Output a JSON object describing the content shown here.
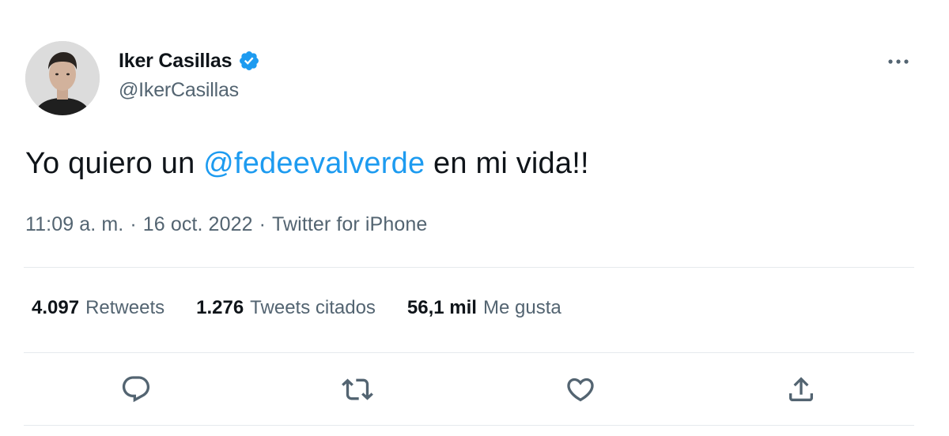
{
  "author": {
    "display_name": "Iker Casillas",
    "handle": "@IkerCasillas",
    "verified_icon": "verified-badge-icon",
    "avatar": "profile-photo"
  },
  "tweet": {
    "text_before": "Yo quiero un ",
    "mention": "@fedeevalverde",
    "text_after": " en mi vida!!",
    "time": "11:09 a. m.",
    "separator": "·",
    "date": "16 oct. 2022",
    "source": "Twitter for iPhone"
  },
  "stats": {
    "retweets": {
      "count": "4.097",
      "label": "Retweets"
    },
    "quotes": {
      "count": "1.276",
      "label": "Tweets citados"
    },
    "likes": {
      "count": "56,1 mil",
      "label": "Me gusta"
    }
  },
  "actions": [
    "reply-icon",
    "retweet-icon",
    "like-icon",
    "share-icon"
  ],
  "colors": {
    "accent": "#1d9bf0",
    "text": "#0f1419",
    "secondary": "#536471",
    "divider": "#e6eaed"
  }
}
